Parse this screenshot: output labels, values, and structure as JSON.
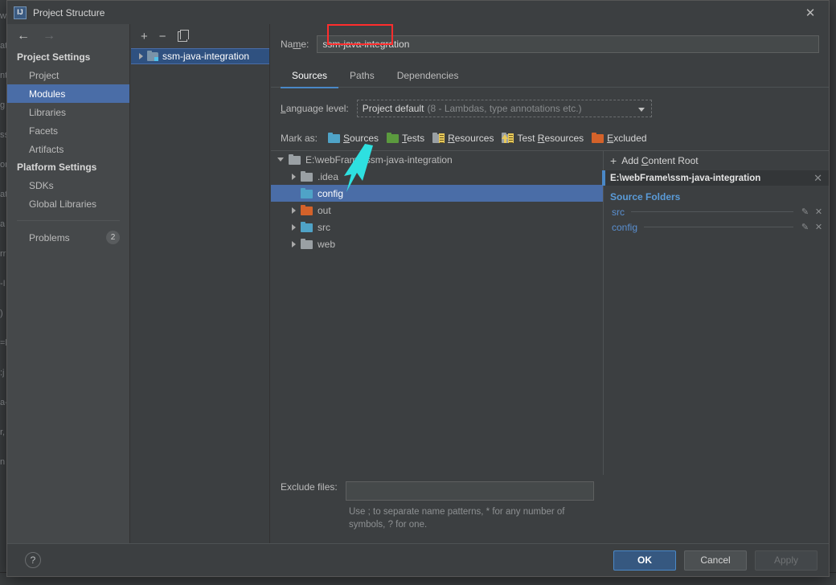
{
  "background": {
    "left_fragments": [
      "w",
      "at",
      "nt",
      "g",
      "ss",
      "on",
      "at",
      "a",
      "rr",
      "-I",
      ")",
      "=b",
      ":j",
      "a-",
      "r,",
      "n"
    ],
    "right_fragments": []
  },
  "dialog": {
    "title": "Project Structure",
    "title_icon": "intellij-idea-icon",
    "close_icon": "✕"
  },
  "sidebar": {
    "back_icon": "←",
    "forward_icon": "→",
    "groups": [
      {
        "label": "Project Settings",
        "items": [
          {
            "label": "Project",
            "selected": false
          },
          {
            "label": "Modules",
            "selected": true
          },
          {
            "label": "Libraries",
            "selected": false
          },
          {
            "label": "Facets",
            "selected": false
          },
          {
            "label": "Artifacts",
            "selected": false
          }
        ]
      },
      {
        "label": "Platform Settings",
        "items": [
          {
            "label": "SDKs",
            "selected": false
          },
          {
            "label": "Global Libraries",
            "selected": false
          }
        ]
      }
    ],
    "problems": {
      "label": "Problems",
      "badge": "2"
    }
  },
  "modules_panel": {
    "toolbar": {
      "add_icon": "+",
      "remove_icon": "−",
      "copy_icon": "copy-icon"
    },
    "module": {
      "name": "ssm-java-integration",
      "expander": "▶",
      "icon": "module-icon",
      "selected": true
    }
  },
  "main": {
    "name_label": "Name:",
    "name_label_mnemonic": "m",
    "name_value": "ssm-java-integration",
    "name_placeholder": "",
    "tabs": [
      {
        "label": "Sources",
        "active": true
      },
      {
        "label": "Paths",
        "active": false
      },
      {
        "label": "Dependencies",
        "active": false
      }
    ],
    "language_level": {
      "label": "Language level:",
      "value": "Project default",
      "hint": "(8 - Lambdas, type annotations etc.)",
      "caret_icon": "chevron-down-icon"
    },
    "mark_as": {
      "label": "Mark as:",
      "buttons": [
        {
          "label": "Sources",
          "icon": "folder-blue-icon",
          "color": "#4fa3c7",
          "highlighted": true
        },
        {
          "label": "Tests",
          "icon": "folder-green-icon",
          "color": "#5b9a3e",
          "highlighted": false
        },
        {
          "label": "Resources",
          "icon": "folder-resources-icon",
          "color": "#9aa0a4",
          "highlighted": false
        },
        {
          "label": "Test Resources",
          "icon": "folder-test-resources-icon",
          "color": "#9aa0a4",
          "highlighted": false
        },
        {
          "label": "Excluded",
          "icon": "folder-orange-icon",
          "color": "#d4622a",
          "highlighted": false
        }
      ],
      "highlight_color": "#ff2d2d"
    },
    "tree": [
      {
        "label": "E:\\webFrame\\ssm-java-integration",
        "depth": 0,
        "expander": "down",
        "icon": "gray",
        "selected": false
      },
      {
        "label": ".idea",
        "depth": 1,
        "expander": "right",
        "icon": "gray",
        "selected": false
      },
      {
        "label": "config",
        "depth": 1,
        "expander": "none",
        "icon": "blue",
        "selected": true
      },
      {
        "label": "out",
        "depth": 1,
        "expander": "right",
        "icon": "orange",
        "selected": false
      },
      {
        "label": "src",
        "depth": 1,
        "expander": "right",
        "icon": "blue",
        "selected": false
      },
      {
        "label": "web",
        "depth": 1,
        "expander": "right",
        "icon": "gray",
        "selected": false
      }
    ],
    "content_root_panel": {
      "add_label": "Add Content Root",
      "add_icon": "plus-icon",
      "root_path": "E:\\webFrame\\ssm-java-integration",
      "root_close_icon": "✕",
      "source_folders_title": "Source Folders",
      "source_folders": [
        {
          "name": "src",
          "edit_icon": "pencil-icon",
          "remove_icon": "✕"
        },
        {
          "name": "config",
          "edit_icon": "pencil-icon",
          "remove_icon": "✕"
        }
      ]
    },
    "exclude": {
      "label": "Exclude files:",
      "value": "",
      "placeholder": "",
      "hint": "Use ; to separate name patterns, * for any number of symbols, ? for one."
    }
  },
  "footer": {
    "help_label": "?",
    "buttons": [
      {
        "label": "OK",
        "style": "primary"
      },
      {
        "label": "Cancel",
        "style": "normal"
      },
      {
        "label": "Apply",
        "style": "disabled"
      }
    ]
  },
  "annotations": {
    "arrow_color": "#2ee0e0",
    "box_color": "#ff2d2d"
  }
}
